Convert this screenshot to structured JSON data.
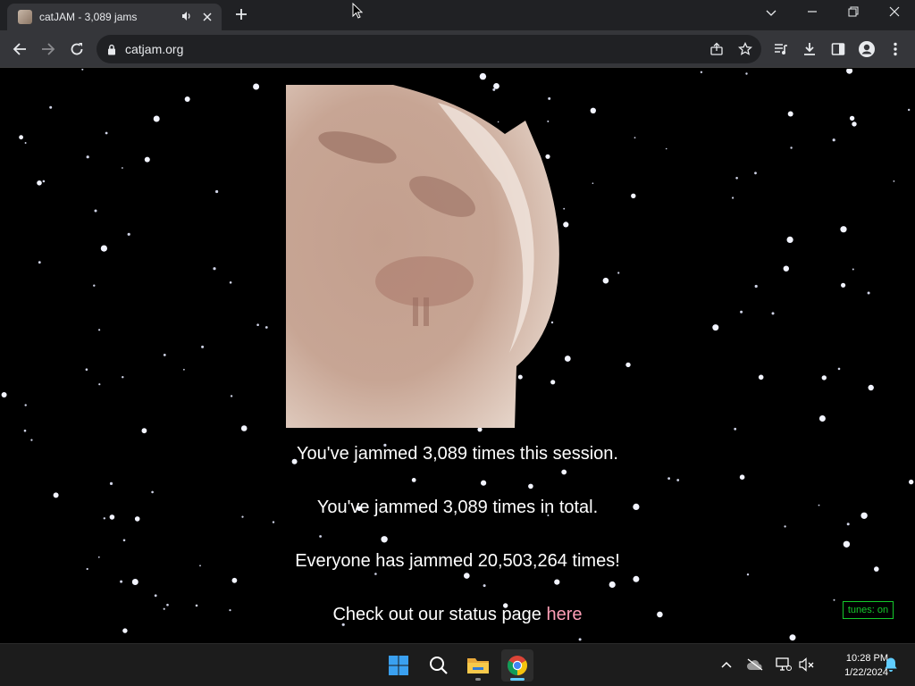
{
  "browser": {
    "tab": {
      "title": "catJAM - 3,089 jams",
      "audio_icon": "speaker-icon",
      "close_icon": "close-icon"
    },
    "new_tab_icon": "plus-icon",
    "window_controls": {
      "list_icon": "chevron-down-icon",
      "minimize_icon": "minimize-icon",
      "restore_icon": "restore-icon",
      "close_icon": "close-icon"
    },
    "toolbar": {
      "back_icon": "arrow-left-icon",
      "forward_icon": "arrow-right-icon",
      "reload_icon": "reload-icon",
      "site_info_icon": "lock-icon",
      "url": "catjam.org",
      "share_icon": "share-icon",
      "bookmark_icon": "star-icon",
      "media_icon": "media-control-icon",
      "download_icon": "download-icon",
      "sidepanel_icon": "side-panel-icon",
      "profile_icon": "profile-icon",
      "menu_icon": "kebab-menu-icon"
    }
  },
  "page": {
    "session_text": "You've jammed 3,089 times this session.",
    "total_text": "You've jammed 3,089 times in total.",
    "everyone_text": "Everyone has jammed 20,503,264 times!",
    "status_prefix": "Check out our status page ",
    "status_link": "here",
    "tunes_label": "tunes: on",
    "colors": {
      "background": "#000000",
      "text": "#ffffff",
      "link": "#ff9fb6",
      "tunes": "#15c92c"
    }
  },
  "taskbar": {
    "apps": [
      {
        "name": "start",
        "icon": "windows-logo-icon"
      },
      {
        "name": "search",
        "icon": "search-icon"
      },
      {
        "name": "file-explorer",
        "icon": "folder-icon"
      },
      {
        "name": "chrome",
        "icon": "chrome-icon"
      }
    ],
    "tray": {
      "overflow_icon": "chevron-up-icon",
      "onedrive_icon": "cloud-off-icon",
      "network_icon": "network-icon",
      "volume_icon": "volume-muted-icon",
      "notification_icon": "bell-icon"
    },
    "time": "10:28 PM",
    "date": "1/22/2024"
  }
}
